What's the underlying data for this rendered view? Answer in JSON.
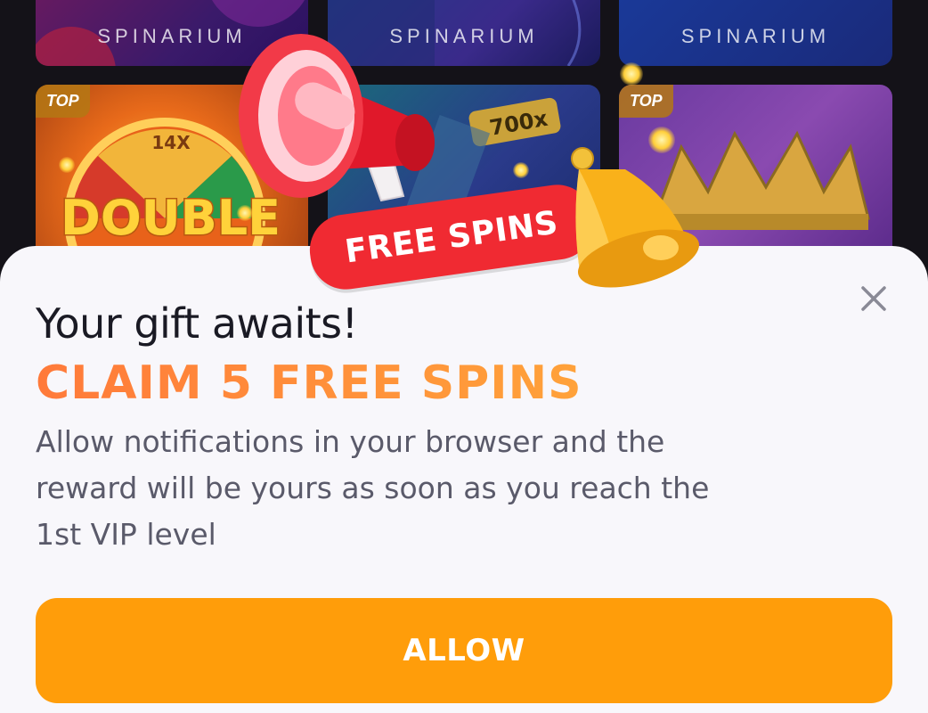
{
  "background_tiles": [
    {
      "brand": "SPINARIUM"
    },
    {
      "brand": "SPINARIUM"
    },
    {
      "brand": "SPINARIUM"
    },
    {
      "badge": "TOP",
      "art_text": "DOUBLE",
      "wheel_label": "14X"
    },
    {
      "art_text": "700x"
    },
    {
      "badge": "TOP"
    }
  ],
  "promo": {
    "ribbon_text": "FREE SPINS",
    "megaphone_icon": "megaphone-icon",
    "bell_icon": "bell-icon"
  },
  "modal": {
    "close_icon": "close-icon",
    "title": "Your gift awaits!",
    "headline": "CLAIM 5 FREE SPINS",
    "description": "Allow notifications in your browser and the reward will be yours as soon as you reach the 1st VIP level",
    "allow_label": "ALLOW"
  },
  "colors": {
    "accent": "#ff9d0a",
    "headline_start": "#ff7a3a",
    "headline_end": "#ffa23a",
    "ribbon": "#f02a32"
  }
}
